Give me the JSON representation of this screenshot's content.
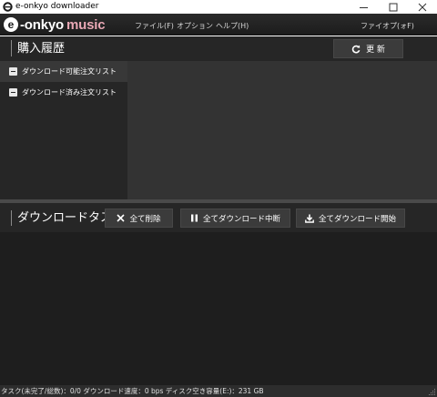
{
  "window": {
    "title": "e-onkyo downloader",
    "minimize_label": "—",
    "maximize_label": "☐",
    "close_label": "✕"
  },
  "logo": {
    "e": "e",
    "dash": "-",
    "onkyo": "onkyo",
    "music": "music"
  },
  "menu": {
    "file": "ファイル(F)",
    "options": "オプション",
    "help": "ヘルプ(H)",
    "right": "ファイオプ(ォF)"
  },
  "purchase": {
    "title": "購入履歴",
    "refresh_label": "更 新",
    "refresh_icon": "refresh-icon"
  },
  "order_list": {
    "items": [
      {
        "label": "ダウンロード可能注文リスト"
      },
      {
        "label": "ダウンロード済み注文リスト"
      }
    ]
  },
  "download": {
    "title": "ダウンロードタスク",
    "delete_all_label": "全て削除",
    "pause_all_label": "全てダウンロード中断",
    "start_all_label": "全てダウンロード開始"
  },
  "status": {
    "text": "タスク(未完了/総数)：0/0  ダウンロード速度：0 bps  ディスク空き容量(E:)：231 GB"
  },
  "colors": {
    "menubar": "#1c1c1c",
    "panel": "#262626",
    "content": "#333333",
    "task_area": "#1e1e1e",
    "music_pink": "#e9a8b5"
  }
}
